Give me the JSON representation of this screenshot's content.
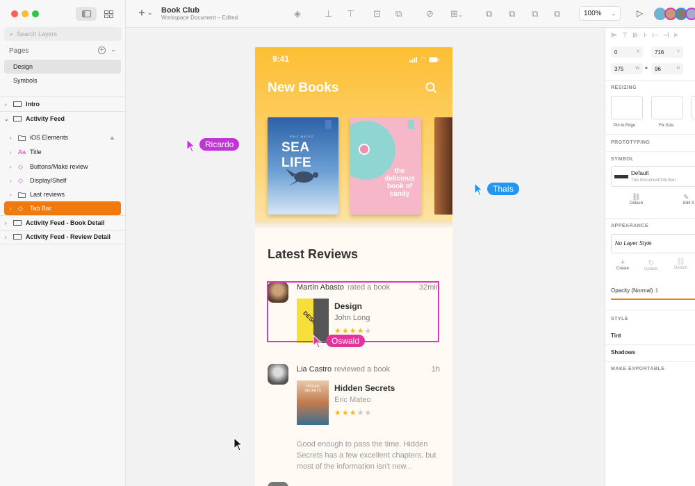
{
  "sidebar": {
    "search_placeholder": "Search Layers",
    "pages_label": "Pages",
    "pages": [
      "Design",
      "Symbols"
    ],
    "layers": [
      {
        "label": "Intro",
        "type": "artboard",
        "bold": true
      },
      {
        "label": "Activity Feed",
        "type": "artboard",
        "bold": true
      },
      {
        "label": "iOS Elements",
        "type": "folder",
        "bold": false
      },
      {
        "label": "Title",
        "type": "text",
        "bold": false
      },
      {
        "label": "Buttons/Make review",
        "type": "symbol",
        "bold": false
      },
      {
        "label": "Display/Shelf",
        "type": "symbol",
        "bold": false
      },
      {
        "label": "Last reviews",
        "type": "folder",
        "bold": false
      },
      {
        "label": "Tab Bar",
        "type": "symbol",
        "bold": false
      },
      {
        "label": "Activity Feed - Book Detail",
        "type": "artboard",
        "bold": true
      },
      {
        "label": "Activity Feed - Review Detail",
        "type": "artboard",
        "bold": true
      }
    ]
  },
  "toolbar": {
    "doc_title": "Book Club",
    "doc_subtitle": "Workspace Document – Edited",
    "zoom": "100%",
    "collab_count": "9"
  },
  "artboard": {
    "status_time": "9:41",
    "header": "New Books",
    "book1_title": "SEA LIFE",
    "book1_author": "ERIC MATEO",
    "book2_title": "the delicious book of candy",
    "section": "Latest Reviews",
    "reviews": [
      {
        "user": "Martín Abasto",
        "action": "rated a book",
        "time": "32min",
        "book": "Design",
        "author": "John Long",
        "rating": 4,
        "cover_text": "DESIGN"
      },
      {
        "user": "Lia Castro",
        "action": "reviewed a book",
        "time": "1h",
        "book": "Hidden Secrets",
        "author": "Eric Mateo",
        "rating": 3,
        "cover_text": "HIDDEN SECRETS",
        "text": "Good enough to pass the time. Hidden Secrets has a few excellent chapters, but most of the information isn't new..."
      }
    ]
  },
  "cursors": [
    {
      "name": "Ricardo",
      "color": "#c234d6"
    },
    {
      "name": "Thaís",
      "color": "#2196f3"
    },
    {
      "name": "Oswald",
      "color": "#e4349b"
    }
  ],
  "inspector": {
    "x": "0",
    "y": "716",
    "w": "375",
    "h": "96",
    "x_label": "X",
    "y_label": "Y",
    "w_label": "W",
    "h_label": "H",
    "resizing": "RESIZING",
    "pin_to_edge": "Pin to Edge",
    "fix_size": "Fix Size",
    "prototyping": "PROTOTYPING",
    "symbol": "SYMBOL",
    "symbol_name": "Default",
    "symbol_path": "This Document/Tab Bar/",
    "detach": "Detach",
    "edit": "Edit S",
    "appearance": "APPEARANCE",
    "layer_style": "No Layer Style",
    "create": "Create",
    "update": "Update",
    "detach2": "Detach",
    "opacity": "Opacity (Normal)",
    "style": "STYLE",
    "tint": "Tint",
    "shadows": "Shadows",
    "make_exportable": "MAKE EXPORTABLE"
  },
  "colors": {
    "accent": "#f07a0d",
    "selection": "#d936c6",
    "hero": "#fdbe33"
  }
}
